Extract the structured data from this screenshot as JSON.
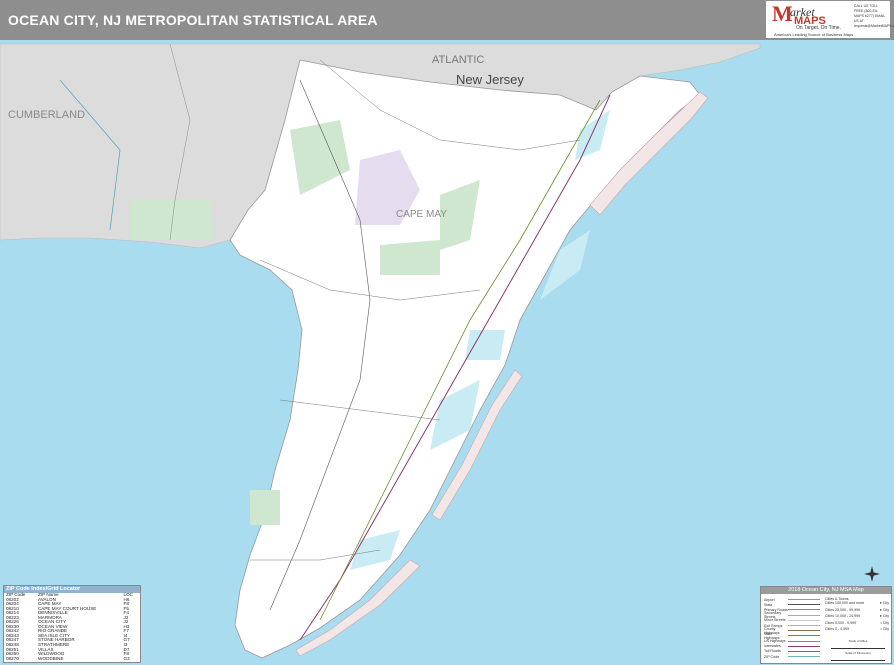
{
  "header": {
    "title": "OCEAN CITY, NJ METROPOLITAN STATISTICAL AREA"
  },
  "logo": {
    "brand_m": "M",
    "brand_arket": "arket",
    "brand_maps": "MAPS",
    "tagline": "On Target. On Time.",
    "subtitle": "America's Leading Source of Business Maps",
    "contact": "CALL US TOLL FREE (800-EA-MAPS 6277) EMAIL US AT requests@MarketMAPS.com"
  },
  "map": {
    "labels": {
      "atlantic": "ATLANTIC",
      "new_jersey": "New Jersey",
      "cumberland": "CUMBERLAND",
      "cape_may": "CAPE MAY"
    },
    "colors": {
      "ocean": "#a9dcef",
      "land": "#ffffff",
      "outside": "#dcdcdc",
      "park": "#cfe6cf",
      "urban": "#e6dcef"
    }
  },
  "zip_index": {
    "title": "ZIP Code Index/Grid Locator",
    "columns": [
      "ZIP Code",
      "ZIP Name",
      "LOC"
    ],
    "rows": [
      [
        "08202",
        "AVALON",
        "H6"
      ],
      [
        "08204",
        "CAPE MAY",
        "F8"
      ],
      [
        "08210",
        "CAPE MAY COURT HOUSE",
        "F5"
      ],
      [
        "08214",
        "DENNISVILLE",
        "F4"
      ],
      [
        "08223",
        "MARMORA",
        "J2"
      ],
      [
        "08226",
        "OCEAN CITY",
        "J2"
      ],
      [
        "08230",
        "OCEAN VIEW",
        "H3"
      ],
      [
        "08242",
        "RIO GRANDE",
        "F7"
      ],
      [
        "08243",
        "SEA ISLE CITY",
        "I4"
      ],
      [
        "08247",
        "STONE HARBOR",
        "G7"
      ],
      [
        "08248",
        "STRATHMERE",
        "I3"
      ],
      [
        "08251",
        "VILLAS",
        "D7"
      ],
      [
        "08260",
        "WILDWOOD",
        "F8"
      ],
      [
        "08270",
        "WOODBINE",
        "G3"
      ]
    ]
  },
  "legend": {
    "title": "2018 Ocean City, NJ MSA Map",
    "items": [
      "Airport",
      "State",
      "Primary Roads",
      "Secondary Streets",
      "Minor Streets",
      "Exit Ramps",
      "County Highways",
      "State Highways",
      "US Highways",
      "Interstates",
      "Toll Roads",
      "ZIP Code"
    ],
    "item_colors": [
      "#999999",
      "#555555",
      "#888888",
      "#aaaaaa",
      "#cccccc",
      "#b0b0b0",
      "#8a6d4c",
      "#6b8e23",
      "#c07070",
      "#8a3a6b",
      "#4a7a9a",
      "#6fb5c0"
    ],
    "population_title": "Cities & Towns",
    "population": [
      [
        "Cities 100,000 and more",
        "● City"
      ],
      [
        "Cities 25,000 - 99,999",
        "● City"
      ],
      [
        "Cities 10,000 - 24,999",
        "● City"
      ],
      [
        "Cities 5,000 - 9,999",
        "• City"
      ],
      [
        "Cities 0 - 4,999",
        "• City"
      ]
    ],
    "scale_miles": "Scale of Miles",
    "scale_km": "Scale of Kilometers"
  }
}
